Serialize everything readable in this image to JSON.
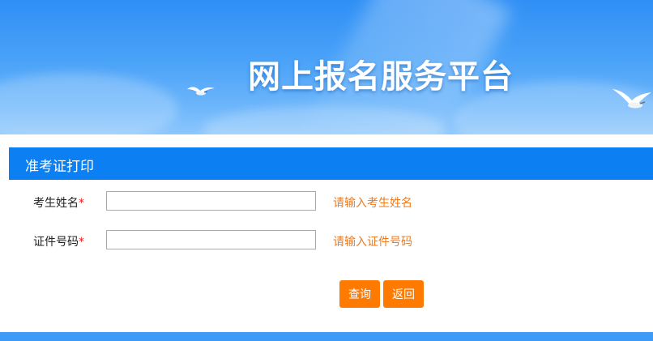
{
  "banner": {
    "title": "网上报名服务平台"
  },
  "panel": {
    "title": "准考证打印"
  },
  "form": {
    "name": {
      "label": "考生姓名",
      "required_mark": "*",
      "value": "",
      "hint": "请输入考生姓名"
    },
    "id_number": {
      "label": "证件号码",
      "required_mark": "*",
      "value": "",
      "hint": "请输入证件号码"
    }
  },
  "actions": {
    "query_label": "查询",
    "back_label": "返回"
  },
  "colors": {
    "banner_blue": "#2f8ff5",
    "header_blue": "#0c80f3",
    "button_orange": "#ff7a00",
    "hint_orange": "#ee7a1e",
    "required_red": "#e02020"
  }
}
